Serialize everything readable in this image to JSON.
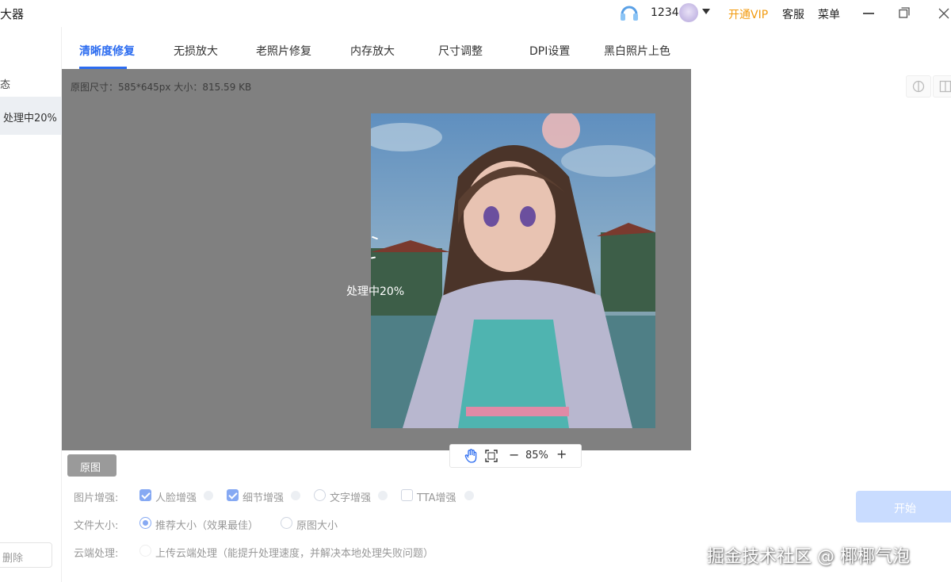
{
  "titlebar": {
    "app_title": "大器",
    "user_name": "1234",
    "vip_label": "开通VIP",
    "service_label": "客服",
    "menu_label": "菜单"
  },
  "sidebar": {
    "status_label": "态",
    "item_label": "处理中20%",
    "delete_label": "删除"
  },
  "tabs": [
    {
      "label": "清晰度修复",
      "active": true
    },
    {
      "label": "无损放大"
    },
    {
      "label": "老照片修复"
    },
    {
      "label": "内存放大"
    },
    {
      "label": "尺寸调整"
    },
    {
      "label": "DPI设置"
    },
    {
      "label": "黑白照片上色"
    }
  ],
  "preview": {
    "info_text": "原图尺寸：585*645px  大小：815.59 KB",
    "loading_text": "处理中20%"
  },
  "zoom": {
    "out_label": "−",
    "level": "85%",
    "in_label": "+"
  },
  "original_button": "原图",
  "options": {
    "enhance": {
      "label": "图片增强:",
      "items": [
        {
          "label": "人脸增强",
          "checked": true
        },
        {
          "label": "细节增强",
          "checked": true
        },
        {
          "label": "文字增强",
          "checked": false
        },
        {
          "label": "TTA增强",
          "checked": false
        }
      ]
    },
    "filesize": {
      "label": "文件大小:",
      "items": [
        {
          "label": "推荐大小（效果最佳）",
          "selected": true
        },
        {
          "label": "原图大小",
          "selected": false
        }
      ]
    },
    "cloud": {
      "label": "云端处理:",
      "item": "上传云端处理（能提升处理速度，并解决本地处理失败问题）",
      "checked": false
    }
  },
  "right_panel": {
    "start_label": "开始"
  },
  "watermark": "掘金技术社区 @ 椰椰气泡",
  "colors": {
    "accent": "#2c6cf0",
    "vip": "#f29a0e",
    "preview_bg": "#808080",
    "start_button": "#c9dcff"
  }
}
